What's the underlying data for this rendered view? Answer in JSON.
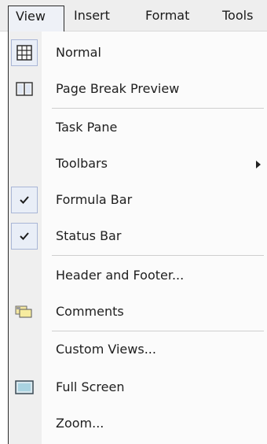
{
  "menubar": {
    "items": [
      {
        "label": "View",
        "active": true
      },
      {
        "label": "Insert"
      },
      {
        "label": "Format"
      },
      {
        "label": "Tools"
      }
    ]
  },
  "view_menu": {
    "items": [
      {
        "label": "Normal",
        "icon": "normal-view-icon"
      },
      {
        "label": "Page Break Preview",
        "icon": "page-break-preview-icon"
      },
      {
        "label": "Task Pane"
      },
      {
        "label": "Toolbars",
        "has_submenu": true
      },
      {
        "label": "Formula Bar",
        "checked": true
      },
      {
        "label": "Status Bar",
        "checked": true
      },
      {
        "label": "Header and Footer..."
      },
      {
        "label": "Comments",
        "icon": "comments-icon"
      },
      {
        "label": "Custom Views..."
      },
      {
        "label": "Full Screen",
        "icon": "full-screen-icon"
      },
      {
        "label": "Zoom..."
      }
    ]
  },
  "colors": {
    "menu_background": "#fbfbfb",
    "gutter": "#efefef",
    "check_highlight": "#e9eef7",
    "text": "#202020"
  }
}
